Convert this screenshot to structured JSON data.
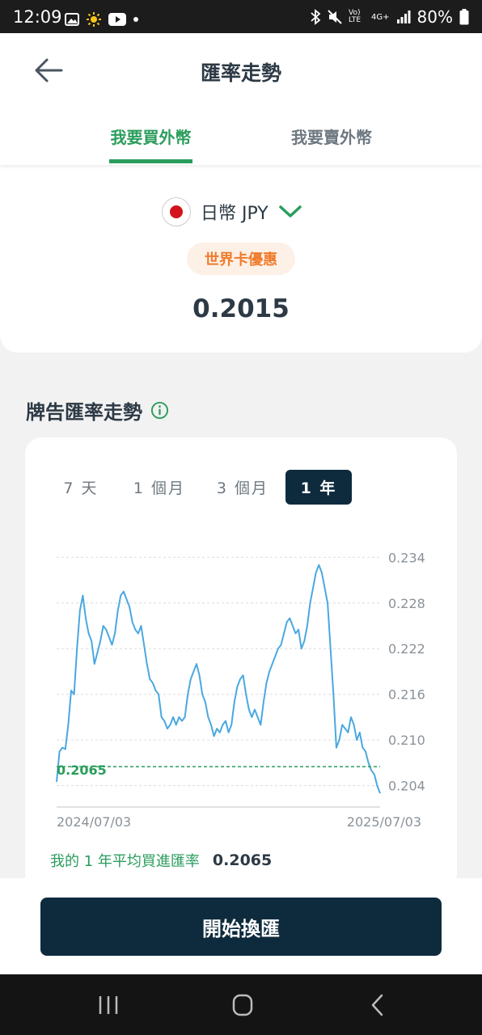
{
  "status_bar": {
    "time": "12:09",
    "battery": "80%",
    "network": "4G+",
    "volte": "Vo) LTE"
  },
  "header": {
    "title": "匯率走勢",
    "tabs": [
      {
        "label": "我要買外幣",
        "active": true
      },
      {
        "label": "我要賣外幣",
        "active": false
      }
    ]
  },
  "currency": {
    "name": "日幣 JPY",
    "flag": "japan-flag",
    "badge": "世界卡優惠",
    "rate": "0.2015"
  },
  "trend": {
    "section_title": "牌告匯率走勢",
    "periods": [
      {
        "label": "7 天",
        "active": false
      },
      {
        "label": "1 個月",
        "active": false
      },
      {
        "label": "3 個月",
        "active": false
      },
      {
        "label": "1 年",
        "active": true
      }
    ],
    "avg_marker_label": "0.2065",
    "avg_label": "我的 1 年平均買進匯率",
    "avg_value": "0.2065"
  },
  "chart_data": {
    "type": "line",
    "title": "",
    "xlabel": "",
    "ylabel": "",
    "x_ticks": [
      "2024/07/03",
      "2025/07/03"
    ],
    "y_ticks": [
      0.234,
      0.228,
      0.222,
      0.216,
      0.21,
      0.204
    ],
    "ylim": [
      0.2012,
      0.2352
    ],
    "grid": true,
    "reference_line": {
      "value": 0.2065,
      "label": "0.2065",
      "color": "#2a9d5c",
      "style": "dashed"
    },
    "series": [
      {
        "color": "#4aa8e0",
        "values": [
          0.2045,
          0.2085,
          0.209,
          0.2088,
          0.212,
          0.2165,
          0.216,
          0.222,
          0.227,
          0.229,
          0.226,
          0.224,
          0.223,
          0.22,
          0.2215,
          0.223,
          0.225,
          0.2245,
          0.2235,
          0.2225,
          0.224,
          0.227,
          0.229,
          0.2295,
          0.2285,
          0.2275,
          0.2255,
          0.2245,
          0.224,
          0.225,
          0.2225,
          0.22,
          0.218,
          0.2175,
          0.2165,
          0.216,
          0.213,
          0.2125,
          0.2115,
          0.212,
          0.213,
          0.212,
          0.213,
          0.2125,
          0.213,
          0.216,
          0.218,
          0.219,
          0.22,
          0.2185,
          0.216,
          0.215,
          0.213,
          0.212,
          0.2105,
          0.2115,
          0.211,
          0.212,
          0.2125,
          0.211,
          0.212,
          0.215,
          0.217,
          0.218,
          0.2185,
          0.216,
          0.214,
          0.213,
          0.214,
          0.213,
          0.212,
          0.215,
          0.2175,
          0.219,
          0.22,
          0.221,
          0.222,
          0.2225,
          0.224,
          0.2255,
          0.226,
          0.225,
          0.224,
          0.2245,
          0.222,
          0.223,
          0.225,
          0.228,
          0.23,
          0.232,
          0.233,
          0.232,
          0.23,
          0.228,
          0.222,
          0.216,
          0.209,
          0.21,
          0.212,
          0.2115,
          0.211,
          0.213,
          0.212,
          0.21,
          0.211,
          0.209,
          0.2085,
          0.207,
          0.206,
          0.2055,
          0.204,
          0.203
        ]
      }
    ]
  },
  "bottom": {
    "cta_label": "開始換匯"
  },
  "colors": {
    "accent_green": "#2a9d5c",
    "navy": "#0e2b3d",
    "badge_orange": "#ef7b2c",
    "line_blue": "#4aa8e0"
  }
}
